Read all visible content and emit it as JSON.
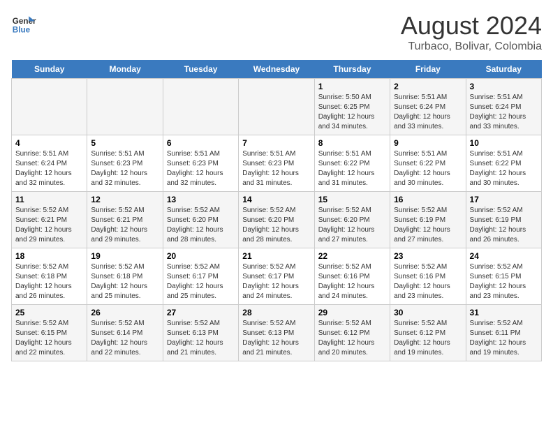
{
  "header": {
    "logo_line1": "General",
    "logo_line2": "Blue",
    "month_title": "August 2024",
    "location": "Turbaco, Bolivar, Colombia"
  },
  "weekdays": [
    "Sunday",
    "Monday",
    "Tuesday",
    "Wednesday",
    "Thursday",
    "Friday",
    "Saturday"
  ],
  "weeks": [
    [
      {
        "day": "",
        "info": ""
      },
      {
        "day": "",
        "info": ""
      },
      {
        "day": "",
        "info": ""
      },
      {
        "day": "",
        "info": ""
      },
      {
        "day": "1",
        "info": "Sunrise: 5:50 AM\nSunset: 6:25 PM\nDaylight: 12 hours\nand 34 minutes."
      },
      {
        "day": "2",
        "info": "Sunrise: 5:51 AM\nSunset: 6:24 PM\nDaylight: 12 hours\nand 33 minutes."
      },
      {
        "day": "3",
        "info": "Sunrise: 5:51 AM\nSunset: 6:24 PM\nDaylight: 12 hours\nand 33 minutes."
      }
    ],
    [
      {
        "day": "4",
        "info": "Sunrise: 5:51 AM\nSunset: 6:24 PM\nDaylight: 12 hours\nand 32 minutes."
      },
      {
        "day": "5",
        "info": "Sunrise: 5:51 AM\nSunset: 6:23 PM\nDaylight: 12 hours\nand 32 minutes."
      },
      {
        "day": "6",
        "info": "Sunrise: 5:51 AM\nSunset: 6:23 PM\nDaylight: 12 hours\nand 32 minutes."
      },
      {
        "day": "7",
        "info": "Sunrise: 5:51 AM\nSunset: 6:23 PM\nDaylight: 12 hours\nand 31 minutes."
      },
      {
        "day": "8",
        "info": "Sunrise: 5:51 AM\nSunset: 6:22 PM\nDaylight: 12 hours\nand 31 minutes."
      },
      {
        "day": "9",
        "info": "Sunrise: 5:51 AM\nSunset: 6:22 PM\nDaylight: 12 hours\nand 30 minutes."
      },
      {
        "day": "10",
        "info": "Sunrise: 5:51 AM\nSunset: 6:22 PM\nDaylight: 12 hours\nand 30 minutes."
      }
    ],
    [
      {
        "day": "11",
        "info": "Sunrise: 5:52 AM\nSunset: 6:21 PM\nDaylight: 12 hours\nand 29 minutes."
      },
      {
        "day": "12",
        "info": "Sunrise: 5:52 AM\nSunset: 6:21 PM\nDaylight: 12 hours\nand 29 minutes."
      },
      {
        "day": "13",
        "info": "Sunrise: 5:52 AM\nSunset: 6:20 PM\nDaylight: 12 hours\nand 28 minutes."
      },
      {
        "day": "14",
        "info": "Sunrise: 5:52 AM\nSunset: 6:20 PM\nDaylight: 12 hours\nand 28 minutes."
      },
      {
        "day": "15",
        "info": "Sunrise: 5:52 AM\nSunset: 6:20 PM\nDaylight: 12 hours\nand 27 minutes."
      },
      {
        "day": "16",
        "info": "Sunrise: 5:52 AM\nSunset: 6:19 PM\nDaylight: 12 hours\nand 27 minutes."
      },
      {
        "day": "17",
        "info": "Sunrise: 5:52 AM\nSunset: 6:19 PM\nDaylight: 12 hours\nand 26 minutes."
      }
    ],
    [
      {
        "day": "18",
        "info": "Sunrise: 5:52 AM\nSunset: 6:18 PM\nDaylight: 12 hours\nand 26 minutes."
      },
      {
        "day": "19",
        "info": "Sunrise: 5:52 AM\nSunset: 6:18 PM\nDaylight: 12 hours\nand 25 minutes."
      },
      {
        "day": "20",
        "info": "Sunrise: 5:52 AM\nSunset: 6:17 PM\nDaylight: 12 hours\nand 25 minutes."
      },
      {
        "day": "21",
        "info": "Sunrise: 5:52 AM\nSunset: 6:17 PM\nDaylight: 12 hours\nand 24 minutes."
      },
      {
        "day": "22",
        "info": "Sunrise: 5:52 AM\nSunset: 6:16 PM\nDaylight: 12 hours\nand 24 minutes."
      },
      {
        "day": "23",
        "info": "Sunrise: 5:52 AM\nSunset: 6:16 PM\nDaylight: 12 hours\nand 23 minutes."
      },
      {
        "day": "24",
        "info": "Sunrise: 5:52 AM\nSunset: 6:15 PM\nDaylight: 12 hours\nand 23 minutes."
      }
    ],
    [
      {
        "day": "25",
        "info": "Sunrise: 5:52 AM\nSunset: 6:15 PM\nDaylight: 12 hours\nand 22 minutes."
      },
      {
        "day": "26",
        "info": "Sunrise: 5:52 AM\nSunset: 6:14 PM\nDaylight: 12 hours\nand 22 minutes."
      },
      {
        "day": "27",
        "info": "Sunrise: 5:52 AM\nSunset: 6:13 PM\nDaylight: 12 hours\nand 21 minutes."
      },
      {
        "day": "28",
        "info": "Sunrise: 5:52 AM\nSunset: 6:13 PM\nDaylight: 12 hours\nand 21 minutes."
      },
      {
        "day": "29",
        "info": "Sunrise: 5:52 AM\nSunset: 6:12 PM\nDaylight: 12 hours\nand 20 minutes."
      },
      {
        "day": "30",
        "info": "Sunrise: 5:52 AM\nSunset: 6:12 PM\nDaylight: 12 hours\nand 19 minutes."
      },
      {
        "day": "31",
        "info": "Sunrise: 5:52 AM\nSunset: 6:11 PM\nDaylight: 12 hours\nand 19 minutes."
      }
    ]
  ]
}
